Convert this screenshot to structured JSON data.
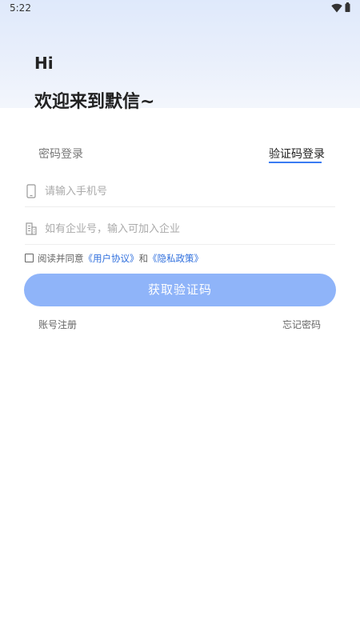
{
  "status_bar": {
    "time": "5:22",
    "icons": [
      "wifi-icon",
      "battery-icon"
    ]
  },
  "greeting": {
    "hi": "Hi",
    "welcome": "欢迎来到默信~"
  },
  "tabs": [
    {
      "label": "密码登录",
      "active": false
    },
    {
      "label": "验证码登录",
      "active": true
    }
  ],
  "form": {
    "phone": {
      "placeholder": "请输入手机号",
      "value": "",
      "icon": "phone-icon"
    },
    "company": {
      "placeholder": "如有企业号，输入可加入企业",
      "value": "",
      "icon": "building-icon"
    }
  },
  "agreement": {
    "checked": false,
    "prefix": "阅读并同意",
    "user_agreement": "《用户协议》",
    "and": "和",
    "privacy_policy": "《隐私政策》"
  },
  "submit_label": "获取验证码",
  "links": {
    "register": "账号注册",
    "forgot_password": "忘记密码"
  },
  "colors": {
    "accent": "#3a7bf2",
    "button_bg": "#8fb4f9",
    "link": "#2f6fdd",
    "hero_gradient_top": "#dfe9fb"
  }
}
